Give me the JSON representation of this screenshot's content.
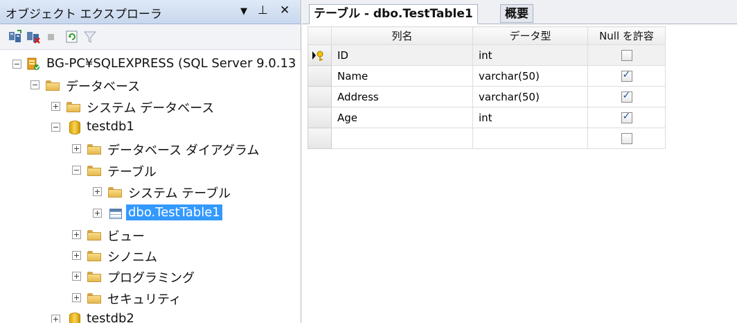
{
  "object_explorer": {
    "title": "オブジェクト エクスプローラ",
    "controls": {
      "dropdown": "▼",
      "pin": "⊥",
      "close": "✕"
    },
    "toolbar": [
      "connect-icon",
      "disconnect-icon",
      "stop-icon",
      "refresh-icon",
      "filter-icon"
    ],
    "tree": [
      {
        "label": "BG-PC¥SQLEXPRESS (SQL Server 9.0.13",
        "icon": "server-icon",
        "expander": "minus"
      },
      {
        "label": "データベース",
        "icon": "folder-icon",
        "expander": "minus"
      },
      {
        "label": "システム データベース",
        "icon": "folder-icon",
        "expander": "plus"
      },
      {
        "label": "testdb1",
        "icon": "database-icon",
        "expander": "minus"
      },
      {
        "label": "データベース ダイアグラム",
        "icon": "folder-icon",
        "expander": "plus"
      },
      {
        "label": "テーブル",
        "icon": "folder-icon",
        "expander": "minus"
      },
      {
        "label": "システム テーブル",
        "icon": "folder-icon",
        "expander": "plus"
      },
      {
        "label": "dbo.TestTable1",
        "icon": "table-icon",
        "expander": "plus",
        "selected": true
      },
      {
        "label": "ビュー",
        "icon": "folder-icon",
        "expander": "plus"
      },
      {
        "label": "シノニム",
        "icon": "folder-icon",
        "expander": "plus"
      },
      {
        "label": "プログラミング",
        "icon": "folder-icon",
        "expander": "plus"
      },
      {
        "label": "セキュリティ",
        "icon": "folder-icon",
        "expander": "plus"
      },
      {
        "label": "testdb2",
        "icon": "database-icon",
        "expander": "plus"
      }
    ]
  },
  "designer": {
    "tabs": [
      {
        "label": "テーブル - dbo.TestTable1",
        "active": true
      },
      {
        "label": "概要",
        "active": false
      }
    ],
    "columns": [
      "列名",
      "データ型",
      "Null を許容"
    ],
    "rows": [
      {
        "name": "ID",
        "type": "int",
        "allow_null": false,
        "primary_key": true
      },
      {
        "name": "Name",
        "type": "varchar(50)",
        "allow_null": true
      },
      {
        "name": "Address",
        "type": "varchar(50)",
        "allow_null": true
      },
      {
        "name": "Age",
        "type": "int",
        "allow_null": true
      },
      {
        "name": "",
        "type": "",
        "allow_null": false
      }
    ]
  }
}
